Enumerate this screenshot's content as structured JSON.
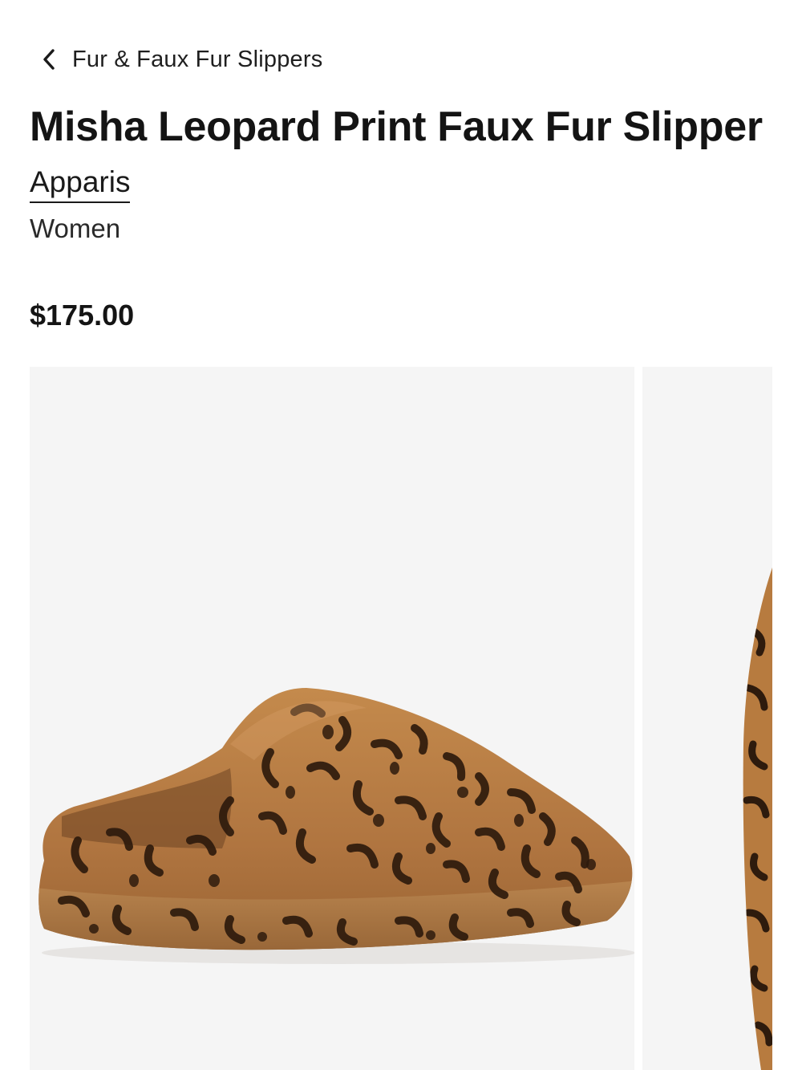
{
  "breadcrumb": {
    "label": "Fur & Faux Fur Slippers",
    "icon": "chevron-left-icon"
  },
  "product": {
    "title": "Misha Leopard Print Faux Fur Slipper",
    "brand": "Apparis",
    "category": "Women",
    "price": "$175.00"
  },
  "gallery": {
    "images": [
      {
        "alt": "Misha Leopard Print Faux Fur Slipper side view"
      },
      {
        "alt": "Misha Leopard Print Faux Fur Slipper alternate view"
      }
    ]
  },
  "colors": {
    "text": "#141414",
    "image_background": "#f5f5f5",
    "fur_base": "#b77b3f",
    "fur_spots": "#2e1b0d"
  }
}
